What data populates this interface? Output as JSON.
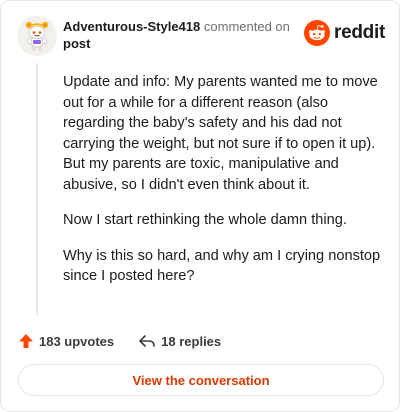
{
  "header": {
    "username": "Adventurous-Style418",
    "action_text": "commented on",
    "post_link": "post"
  },
  "brand": {
    "wordmark": "reddit",
    "color": "#ff4500"
  },
  "comment": {
    "paragraphs": [
      "Update and info: My parents wanted me to move out for a while for a different reason (also regarding the baby's safety and his dad not carrying the weight, but not sure if to open it up). But my parents are toxic, manipulative and abusive, so I didn't even think about it.",
      "Now I start rethinking the whole damn thing.",
      "Why is this so hard, and why am I crying nonstop since I posted here?"
    ]
  },
  "stats": {
    "upvotes": "183 upvotes",
    "replies": "18 replies"
  },
  "cta": {
    "label": "View the conversation",
    "color": "#d93900"
  },
  "icons": {
    "avatar": "snoo-avatar-icon",
    "logo": "reddit-snoo-icon",
    "upvote": "upvote-arrow-icon",
    "reply": "reply-arrow-icon"
  }
}
